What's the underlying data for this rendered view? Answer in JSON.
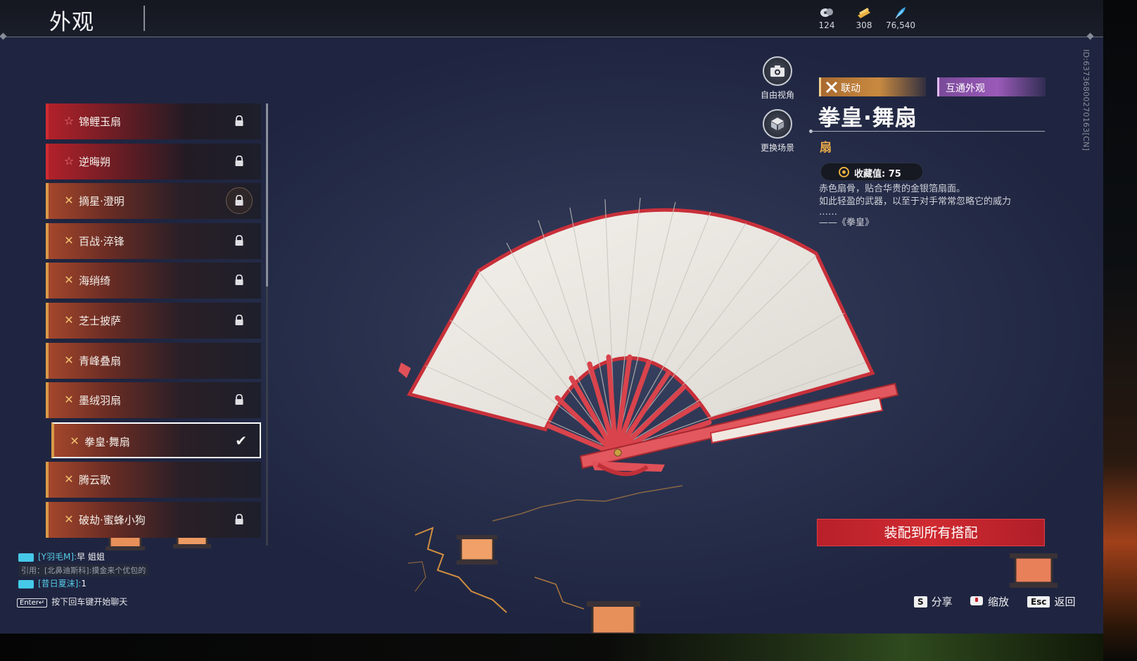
{
  "header": {
    "title": "外观",
    "currencies": [
      {
        "icon": "crystal-currency-icon",
        "value": "124"
      },
      {
        "icon": "ticket-currency-icon",
        "value": "308"
      },
      {
        "icon": "feather-currency-icon",
        "value": "76,540"
      }
    ]
  },
  "items": [
    {
      "label": "锦鲤玉扇",
      "rarity": "red",
      "locked": true
    },
    {
      "label": "逆晦朔",
      "rarity": "red",
      "locked": true
    },
    {
      "label": "摘星·澄明",
      "rarity": "gold",
      "locked": true
    },
    {
      "label": "百战·淬锋",
      "rarity": "gold",
      "locked": true
    },
    {
      "label": "海绡绮",
      "rarity": "gold",
      "locked": true
    },
    {
      "label": "芝士披萨",
      "rarity": "gold",
      "locked": true
    },
    {
      "label": "青峰叠扇",
      "rarity": "gold",
      "locked": false
    },
    {
      "label": "墨绒羽扇",
      "rarity": "gold",
      "locked": true
    },
    {
      "label": "拳皇·舞扇",
      "rarity": "gold",
      "locked": false,
      "selected": true
    },
    {
      "label": "腾云歌",
      "rarity": "gold",
      "locked": false
    },
    {
      "label": "破劫·蜜蜂小狗",
      "rarity": "gold",
      "locked": true
    }
  ],
  "camera": {
    "free_view": "自由视角",
    "change_scene": "更换场景"
  },
  "detail": {
    "tag_collab": "联动",
    "tag_shared": "互通外观",
    "title": "拳皇·舞扇",
    "category": "扇",
    "collection": "收藏值: 75",
    "desc_lines": [
      "赤色扇骨，贴合华贵的金银箔扇面。",
      "如此轻盈的武器，以至于对手常常忽略它的威力",
      "……",
      "——《拳皇》"
    ],
    "equip_all": "装配到所有搭配"
  },
  "version_id": "ID:63736800270163[CN]",
  "chat": {
    "line1_name": "[Y羽毛M]:",
    "line1_msg": "早 姐姐",
    "line2_quote": "引用：[北鼻迪斯科]:摸金来个优包的",
    "line3_name": "[昔日夏沫]:",
    "line3_msg": "1",
    "hint_key": "Enter↵",
    "hint_text": "按下回车键开始聊天"
  },
  "hints": {
    "share_key": "S",
    "share": "分享",
    "zoom": "缩放",
    "back_key": "Esc",
    "back": "返回"
  },
  "colors": {
    "accent_red": "#cf2a30",
    "gold": "#e8a848",
    "chat_name": "#56cce8",
    "purple_tag": "#9a5ab8"
  }
}
